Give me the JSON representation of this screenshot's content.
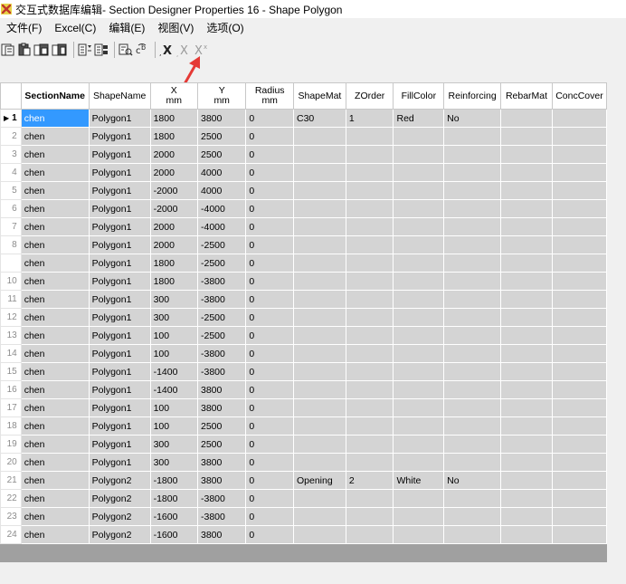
{
  "window": {
    "title": "交互式数据库编辑- Section Designer Properties 16 - Shape Polygon"
  },
  "menu": [
    "文件(F)",
    "Excel(C)",
    "编辑(E)",
    "视图(V)",
    "选项(O)"
  ],
  "toolbar": {
    "icons": [
      "copy-table-icon",
      "paste-icon",
      "paste-append-icon",
      "paste-special-icon",
      "sort-icon",
      "filter-icon",
      "find-icon",
      "replace-icon",
      "delete-rows-icon",
      "delete-columns-icon",
      "delete-all-icon"
    ]
  },
  "grid": {
    "columns": [
      {
        "label": "SectionName",
        "unit": "",
        "bold": true
      },
      {
        "label": "ShapeName",
        "unit": ""
      },
      {
        "label": "X",
        "unit": "mm"
      },
      {
        "label": "Y",
        "unit": "mm"
      },
      {
        "label": "Radius",
        "unit": "mm"
      },
      {
        "label": "ShapeMat",
        "unit": ""
      },
      {
        "label": "ZOrder",
        "unit": ""
      },
      {
        "label": "FillColor",
        "unit": ""
      },
      {
        "label": "Reinforcing",
        "unit": ""
      },
      {
        "label": "RebarMat",
        "unit": ""
      },
      {
        "label": "ConcCover",
        "unit": ""
      }
    ],
    "rows": [
      {
        "num": "1",
        "cells": [
          "chen",
          "Polygon1",
          "1800",
          "3800",
          "0",
          "C30",
          "1",
          "Red",
          "No",
          "",
          ""
        ]
      },
      {
        "num": "2",
        "cells": [
          "chen",
          "Polygon1",
          "1800",
          "2500",
          "0",
          "",
          "",
          "",
          "",
          "",
          ""
        ]
      },
      {
        "num": "3",
        "cells": [
          "chen",
          "Polygon1",
          "2000",
          "2500",
          "0",
          "",
          "",
          "",
          "",
          "",
          ""
        ]
      },
      {
        "num": "4",
        "cells": [
          "chen",
          "Polygon1",
          "2000",
          "4000",
          "0",
          "",
          "",
          "",
          "",
          "",
          ""
        ]
      },
      {
        "num": "5",
        "cells": [
          "chen",
          "Polygon1",
          "-2000",
          "4000",
          "0",
          "",
          "",
          "",
          "",
          "",
          ""
        ]
      },
      {
        "num": "6",
        "cells": [
          "chen",
          "Polygon1",
          "-2000",
          "-4000",
          "0",
          "",
          "",
          "",
          "",
          "",
          ""
        ]
      },
      {
        "num": "7",
        "cells": [
          "chen",
          "Polygon1",
          "2000",
          "-4000",
          "0",
          "",
          "",
          "",
          "",
          "",
          ""
        ]
      },
      {
        "num": "8",
        "cells": [
          "chen",
          "Polygon1",
          "2000",
          "-2500",
          "0",
          "",
          "",
          "",
          "",
          "",
          ""
        ]
      },
      {
        "num": "",
        "cells": [
          "chen",
          "Polygon1",
          "1800",
          "-2500",
          "0",
          "",
          "",
          "",
          "",
          "",
          ""
        ]
      },
      {
        "num": "10",
        "cells": [
          "chen",
          "Polygon1",
          "1800",
          "-3800",
          "0",
          "",
          "",
          "",
          "",
          "",
          ""
        ]
      },
      {
        "num": "11",
        "cells": [
          "chen",
          "Polygon1",
          "300",
          "-3800",
          "0",
          "",
          "",
          "",
          "",
          "",
          ""
        ]
      },
      {
        "num": "12",
        "cells": [
          "chen",
          "Polygon1",
          "300",
          "-2500",
          "0",
          "",
          "",
          "",
          "",
          "",
          ""
        ]
      },
      {
        "num": "13",
        "cells": [
          "chen",
          "Polygon1",
          "100",
          "-2500",
          "0",
          "",
          "",
          "",
          "",
          "",
          ""
        ]
      },
      {
        "num": "14",
        "cells": [
          "chen",
          "Polygon1",
          "100",
          "-3800",
          "0",
          "",
          "",
          "",
          "",
          "",
          ""
        ]
      },
      {
        "num": "15",
        "cells": [
          "chen",
          "Polygon1",
          "-1400",
          "-3800",
          "0",
          "",
          "",
          "",
          "",
          "",
          ""
        ]
      },
      {
        "num": "16",
        "cells": [
          "chen",
          "Polygon1",
          "-1400",
          "3800",
          "0",
          "",
          "",
          "",
          "",
          "",
          ""
        ]
      },
      {
        "num": "17",
        "cells": [
          "chen",
          "Polygon1",
          "100",
          "3800",
          "0",
          "",
          "",
          "",
          "",
          "",
          ""
        ]
      },
      {
        "num": "18",
        "cells": [
          "chen",
          "Polygon1",
          "100",
          "2500",
          "0",
          "",
          "",
          "",
          "",
          "",
          ""
        ]
      },
      {
        "num": "19",
        "cells": [
          "chen",
          "Polygon1",
          "300",
          "2500",
          "0",
          "",
          "",
          "",
          "",
          "",
          ""
        ]
      },
      {
        "num": "20",
        "cells": [
          "chen",
          "Polygon1",
          "300",
          "3800",
          "0",
          "",
          "",
          "",
          "",
          "",
          ""
        ]
      },
      {
        "num": "21",
        "cells": [
          "chen",
          "Polygon2",
          "-1800",
          "3800",
          "0",
          "Opening",
          "2",
          "White",
          "No",
          "",
          ""
        ]
      },
      {
        "num": "22",
        "cells": [
          "chen",
          "Polygon2",
          "-1800",
          "-3800",
          "0",
          "",
          "",
          "",
          "",
          "",
          ""
        ]
      },
      {
        "num": "23",
        "cells": [
          "chen",
          "Polygon2",
          "-1600",
          "-3800",
          "0",
          "",
          "",
          "",
          "",
          "",
          ""
        ]
      },
      {
        "num": "24",
        "cells": [
          "chen",
          "Polygon2",
          "-1600",
          "3800",
          "0",
          "",
          "",
          "",
          "",
          "",
          ""
        ]
      }
    ]
  },
  "colors": {
    "selection": "#3399ff",
    "cell_background": "#d4d4d4",
    "annotation_arrow": "#e53935"
  }
}
